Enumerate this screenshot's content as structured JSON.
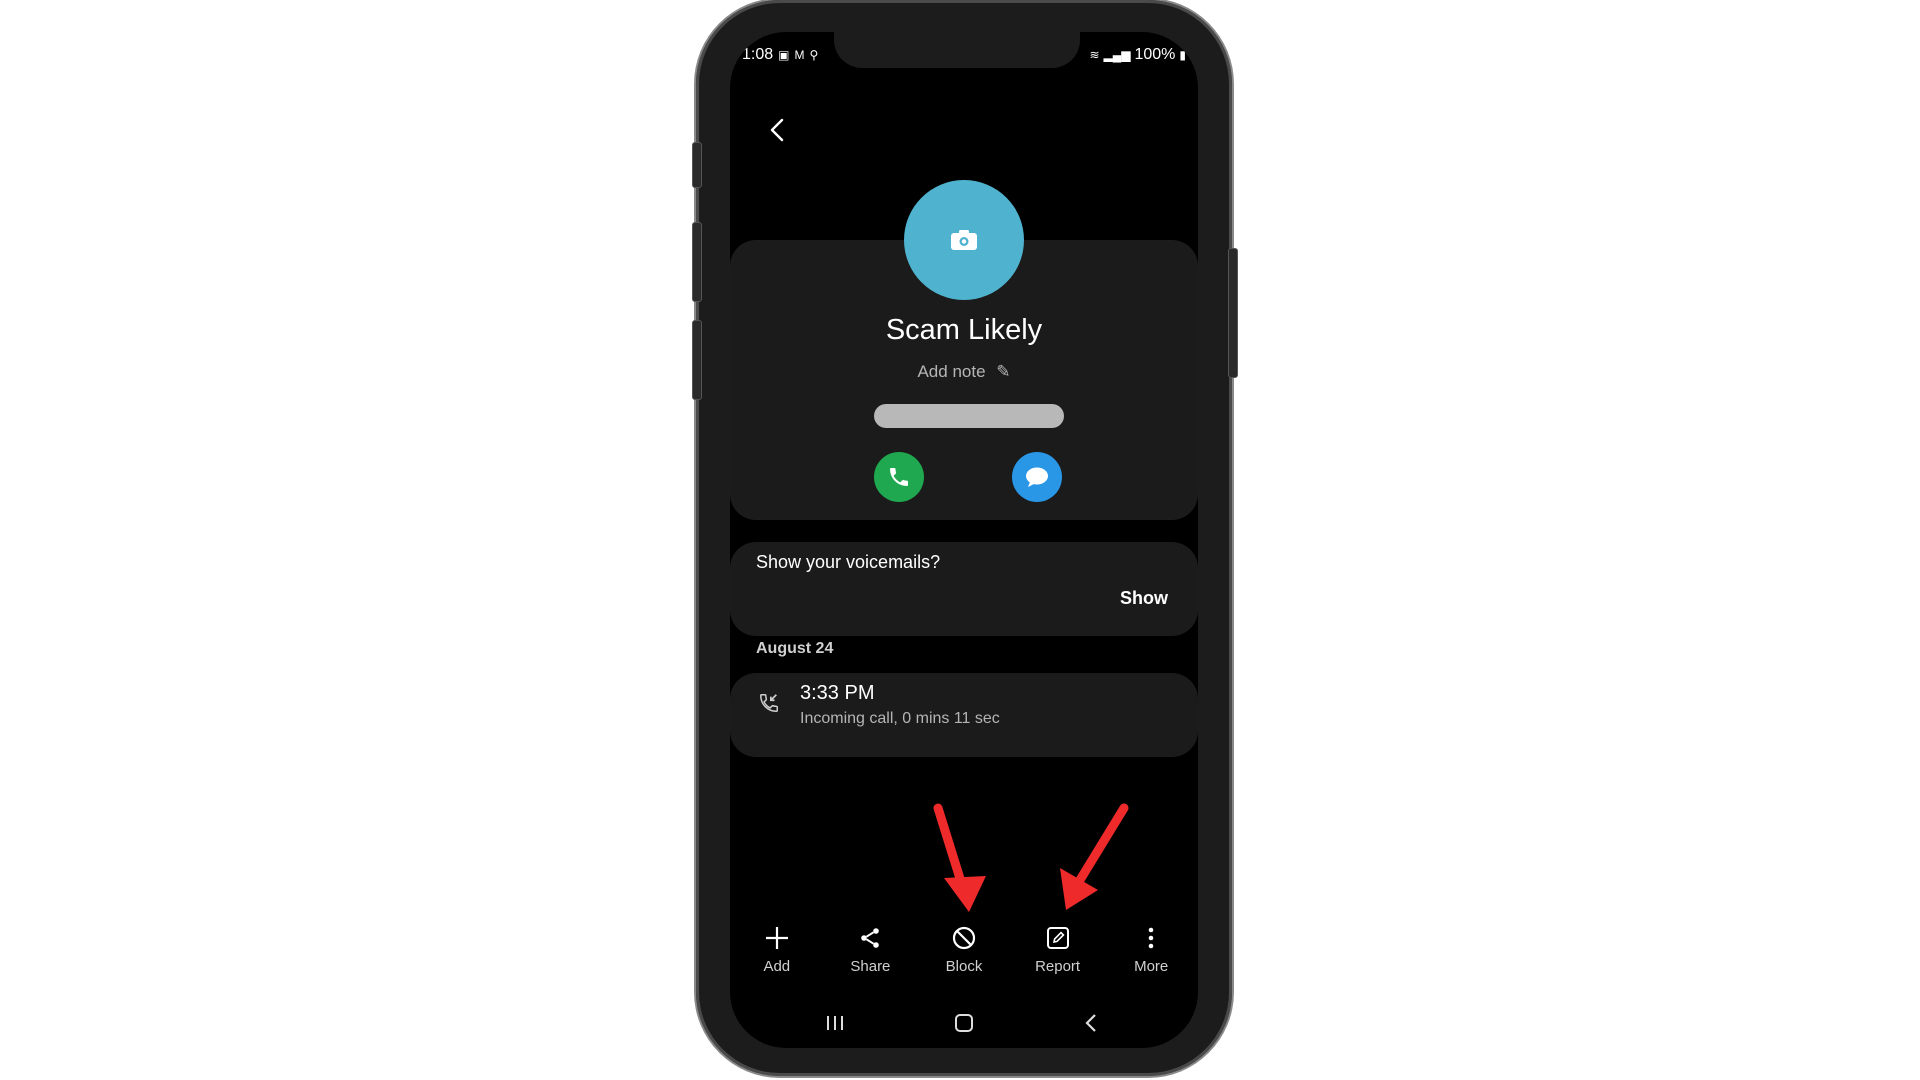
{
  "status_bar": {
    "time": "1:08",
    "battery": "100%"
  },
  "contact": {
    "name": "Scam Likely",
    "add_note": "Add note"
  },
  "voicemail": {
    "prompt": "Show your voicemails?",
    "action": "Show"
  },
  "call_log": {
    "date": "August 24",
    "entries": [
      {
        "time": "3:33 PM",
        "description": "Incoming call, 0 mins 11 sec"
      }
    ]
  },
  "toolbar": {
    "items": [
      {
        "label": "Add",
        "icon": "plus-icon"
      },
      {
        "label": "Share",
        "icon": "share-icon"
      },
      {
        "label": "Block",
        "icon": "block-icon"
      },
      {
        "label": "Report",
        "icon": "report-icon"
      },
      {
        "label": "More",
        "icon": "more-icon"
      }
    ]
  },
  "colors": {
    "avatar": "#4fb3cf",
    "call_button": "#1fa84f",
    "message_button": "#2a96e6",
    "annotation_arrow": "#ee2a2a"
  }
}
